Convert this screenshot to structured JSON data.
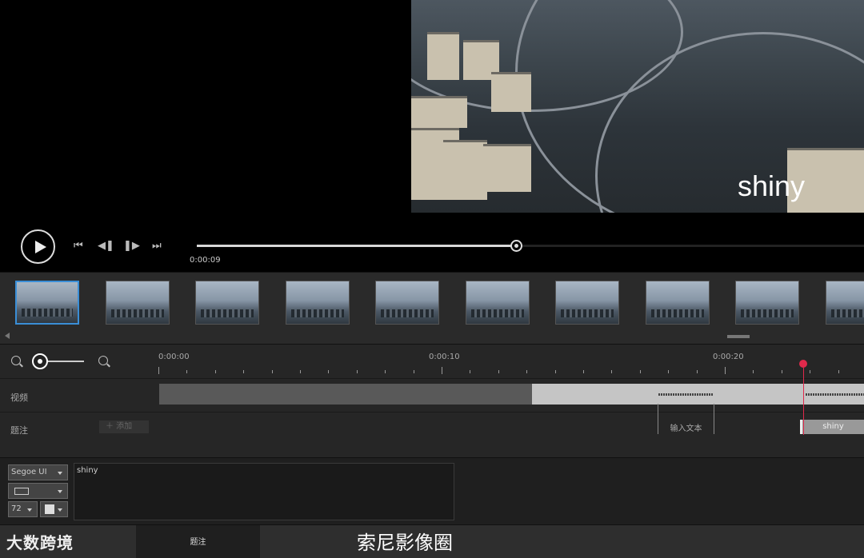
{
  "preview": {
    "caption_overlay": "shiny",
    "current_time": "0:00:09",
    "playback_progress_fraction": 0.48
  },
  "thumbnails": {
    "count": 10,
    "selected_index": 0
  },
  "timeline": {
    "time_labels": [
      "0:00:00",
      "0:00:10",
      "0:00:20"
    ],
    "tracks": {
      "video_label": "视频",
      "caption_label": "题注"
    },
    "add_caption_label": "＋  添加",
    "caption_clips": [
      {
        "text": "输入文本"
      },
      {
        "text": "shiny"
      }
    ]
  },
  "properties": {
    "font": "Segoe UI",
    "font_size": "72",
    "caption_text": "shiny"
  },
  "bottom": {
    "tab_label": "题注",
    "watermark_left": "大数跨境",
    "watermark_right": "索尼影像圈"
  },
  "colors": {
    "playhead": "#e0294b",
    "selected_thumb": "#3a8ed6"
  }
}
